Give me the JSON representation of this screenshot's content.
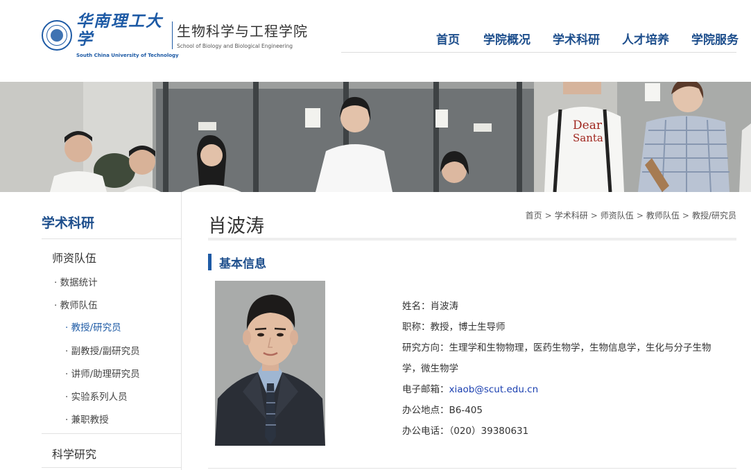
{
  "header": {
    "university_cn": "华南理工大学",
    "university_en": "South China University of Technology",
    "school_cn": "生物科学与工程学院",
    "school_en": "School of Biology and Biological Engineering",
    "brand_color": "#1d5aa5"
  },
  "nav": {
    "items": [
      {
        "label": "首页"
      },
      {
        "label": "学院概况"
      },
      {
        "label": "学术科研"
      },
      {
        "label": "人才培养"
      },
      {
        "label": "学院服务"
      }
    ]
  },
  "banner": {
    "tshirt_text_1": "Dear",
    "tshirt_text_2": "Santa"
  },
  "sidebar": {
    "title": "学术科研",
    "section1": "师资队伍",
    "stats": "· 数据统计",
    "faculty": "· 教师队伍",
    "prof": "· 教授/研究员",
    "assoc": "· 副教授/副研究员",
    "lecturer": "· 讲师/助理研究员",
    "lab": "· 实验系列人员",
    "adjunct": "· 兼职教授",
    "section2": "科学研究"
  },
  "content": {
    "name_title": "肖波涛",
    "breadcrumb": [
      "首页",
      "学术科研",
      "师资队伍",
      "教师队伍",
      "教授/研究员"
    ],
    "breadcrumb_sep": ">",
    "section_heading": "基本信息",
    "info": {
      "name_label": "姓名：",
      "name_value": "肖波涛",
      "title_label": "职称：",
      "title_value": "教授，博士生导师",
      "research_label": "研究方向：",
      "research_value": "生理学和生物物理，医药生物学，生物信息学，生化与分子生物学，微生物学",
      "email_label": "电子邮箱：",
      "email_value": "xiaob@scut.edu.cn",
      "office_label": "办公地点：",
      "office_value": "B6-405",
      "phone_label": "办公电话：",
      "phone_value": "（020）39380631"
    }
  }
}
